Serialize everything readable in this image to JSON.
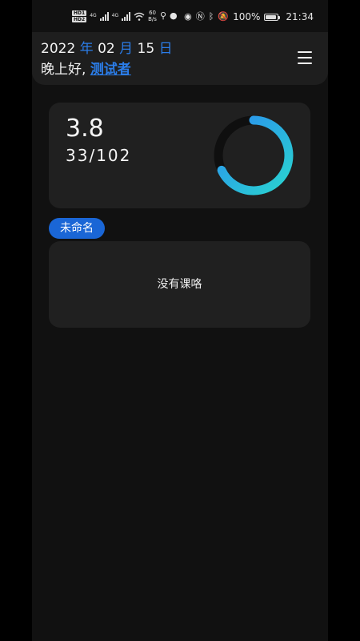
{
  "status_bar": {
    "hd1": "HD1",
    "hd2": "HD2",
    "net1": "4G",
    "net2": "4G",
    "speed_value": "60",
    "speed_unit": "B/s",
    "battery": "100%",
    "time": "21:34"
  },
  "header": {
    "year": "2022",
    "year_char": "年",
    "month": "02",
    "month_char": "月",
    "day": "15",
    "day_char": "日",
    "greeting": "晚上好,",
    "username": "测试者"
  },
  "progress": {
    "score": "3.8",
    "count": "33/102",
    "ring_fraction": 0.68,
    "ring_start_color": "#2b8cf0",
    "ring_end_color": "#2ad4d0"
  },
  "course": {
    "tag": "未命名",
    "empty_text": "没有课咯"
  },
  "colors": {
    "accent": "#2b7de9",
    "tag_bg": "#1a66d6",
    "card_bg": "#202020",
    "page_bg": "#111111"
  }
}
